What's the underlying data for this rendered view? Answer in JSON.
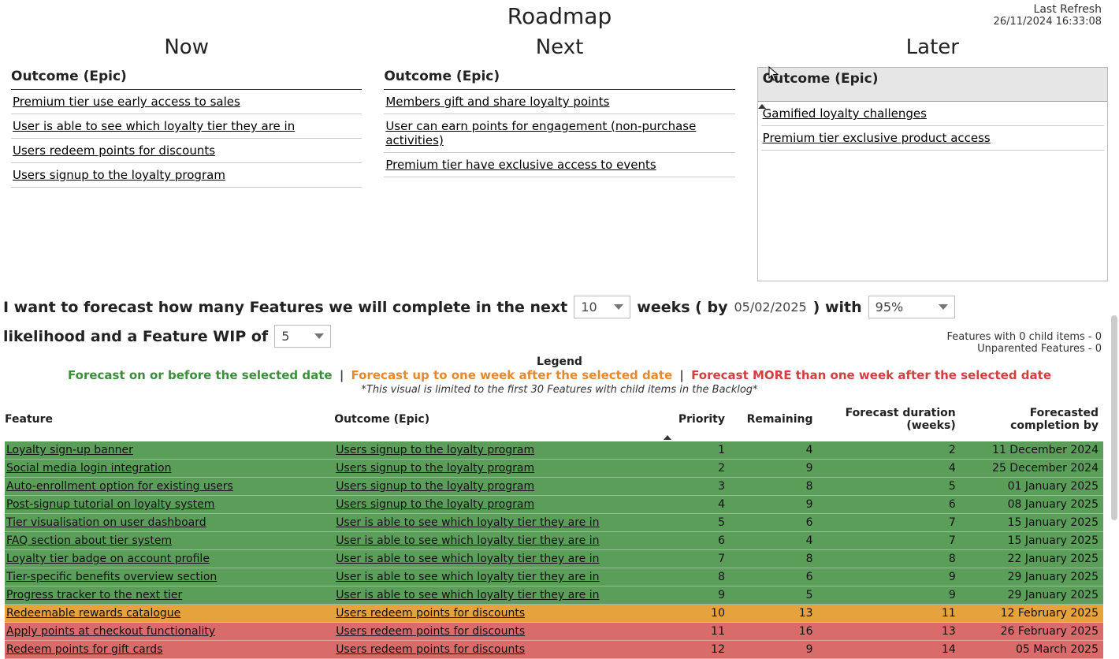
{
  "title": "Roadmap",
  "last_refresh": {
    "label": "Last Refresh",
    "value": "26/11/2024 16:33:08"
  },
  "columns": {
    "now": {
      "title": "Now",
      "header": "Outcome (Epic)",
      "items": [
        "Premium tier use early access to sales",
        "User is able to see which loyalty tier they are in",
        "Users redeem points for discounts",
        "Users signup to the loyalty program"
      ]
    },
    "next": {
      "title": "Next",
      "header": "Outcome (Epic)",
      "items": [
        "Members gift and share loyalty points",
        "User can earn points for engagement (non-purchase activities)",
        "Premium tier have exclusive access to events"
      ]
    },
    "later": {
      "title": "Later",
      "header": "Outcome (Epic)",
      "items": [
        "Gamified loyalty challenges",
        "Premium tier exclusive product access"
      ]
    }
  },
  "sentence": {
    "part1": "I want to forecast how many Features we will complete in the next",
    "weeks_value": "10",
    "part2a": "weeks ( by",
    "by_date": "05/02/2025",
    "part2b": ")  with",
    "likelihood_value": "95%",
    "part3": "likelihood and a Feature WIP of",
    "wip_value": "5"
  },
  "legend": {
    "title": "Legend",
    "green": "Forecast on or before the selected date",
    "orange": "Forecast up to one week after the selected date",
    "red": "Forecast MORE than one week after the selected date",
    "note": "*This visual is limited to the first 30 Features with child items in the Backlog*"
  },
  "right_notes": {
    "line1": "Features with 0 child items - 0",
    "line2": "Unparented Features - 0"
  },
  "table": {
    "headers": {
      "feature": "Feature",
      "outcome": "Outcome (Epic)",
      "priority": "Priority",
      "remaining": "Remaining",
      "duration": "Forecast duration (weeks)",
      "completion": "Forecasted completion by"
    },
    "rows": [
      {
        "status": "green",
        "feature": "Loyalty sign-up banner",
        "outcome": "Users signup to the loyalty program",
        "priority": "1",
        "remaining": "4",
        "duration": "2",
        "completion": "11 December 2024"
      },
      {
        "status": "green",
        "feature": "Social media login integration",
        "outcome": "Users signup to the loyalty program",
        "priority": "2",
        "remaining": "9",
        "duration": "4",
        "completion": "25 December 2024"
      },
      {
        "status": "green",
        "feature": "Auto-enrollment option for existing users",
        "outcome": "Users signup to the loyalty program",
        "priority": "3",
        "remaining": "8",
        "duration": "5",
        "completion": "01 January 2025"
      },
      {
        "status": "green",
        "feature": "Post-signup tutorial on loyalty system",
        "outcome": "Users signup to the loyalty program",
        "priority": "4",
        "remaining": "9",
        "duration": "6",
        "completion": "08 January 2025"
      },
      {
        "status": "green",
        "feature": "Tier visualisation on user dashboard",
        "outcome": "User is able to see which loyalty tier they are in",
        "priority": "5",
        "remaining": "6",
        "duration": "7",
        "completion": "15 January 2025"
      },
      {
        "status": "green",
        "feature": "FAQ section about tier system",
        "outcome": "User is able to see which loyalty tier they are in",
        "priority": "6",
        "remaining": "4",
        "duration": "7",
        "completion": "15 January 2025"
      },
      {
        "status": "green",
        "feature": "Loyalty tier badge on account profile",
        "outcome": "User is able to see which loyalty tier they are in",
        "priority": "7",
        "remaining": "8",
        "duration": "8",
        "completion": "22 January 2025"
      },
      {
        "status": "green",
        "feature": "Tier-specific benefits overview section",
        "outcome": "User is able to see which loyalty tier they are in",
        "priority": "8",
        "remaining": "6",
        "duration": "9",
        "completion": "29 January 2025"
      },
      {
        "status": "green",
        "feature": "Progress tracker to the next tier",
        "outcome": "User is able to see which loyalty tier they are in",
        "priority": "9",
        "remaining": "5",
        "duration": "9",
        "completion": "29 January 2025"
      },
      {
        "status": "orange",
        "feature": "Redeemable rewards catalogue",
        "outcome": "Users redeem points for discounts",
        "priority": "10",
        "remaining": "13",
        "duration": "11",
        "completion": "12 February 2025"
      },
      {
        "status": "red",
        "feature": "Apply points at checkout functionality",
        "outcome": "Users redeem points for discounts",
        "priority": "11",
        "remaining": "16",
        "duration": "13",
        "completion": "26 February 2025"
      },
      {
        "status": "red",
        "feature": "Redeem points for gift cards",
        "outcome": "Users redeem points for discounts",
        "priority": "12",
        "remaining": "9",
        "duration": "14",
        "completion": "05 March 2025"
      }
    ]
  }
}
